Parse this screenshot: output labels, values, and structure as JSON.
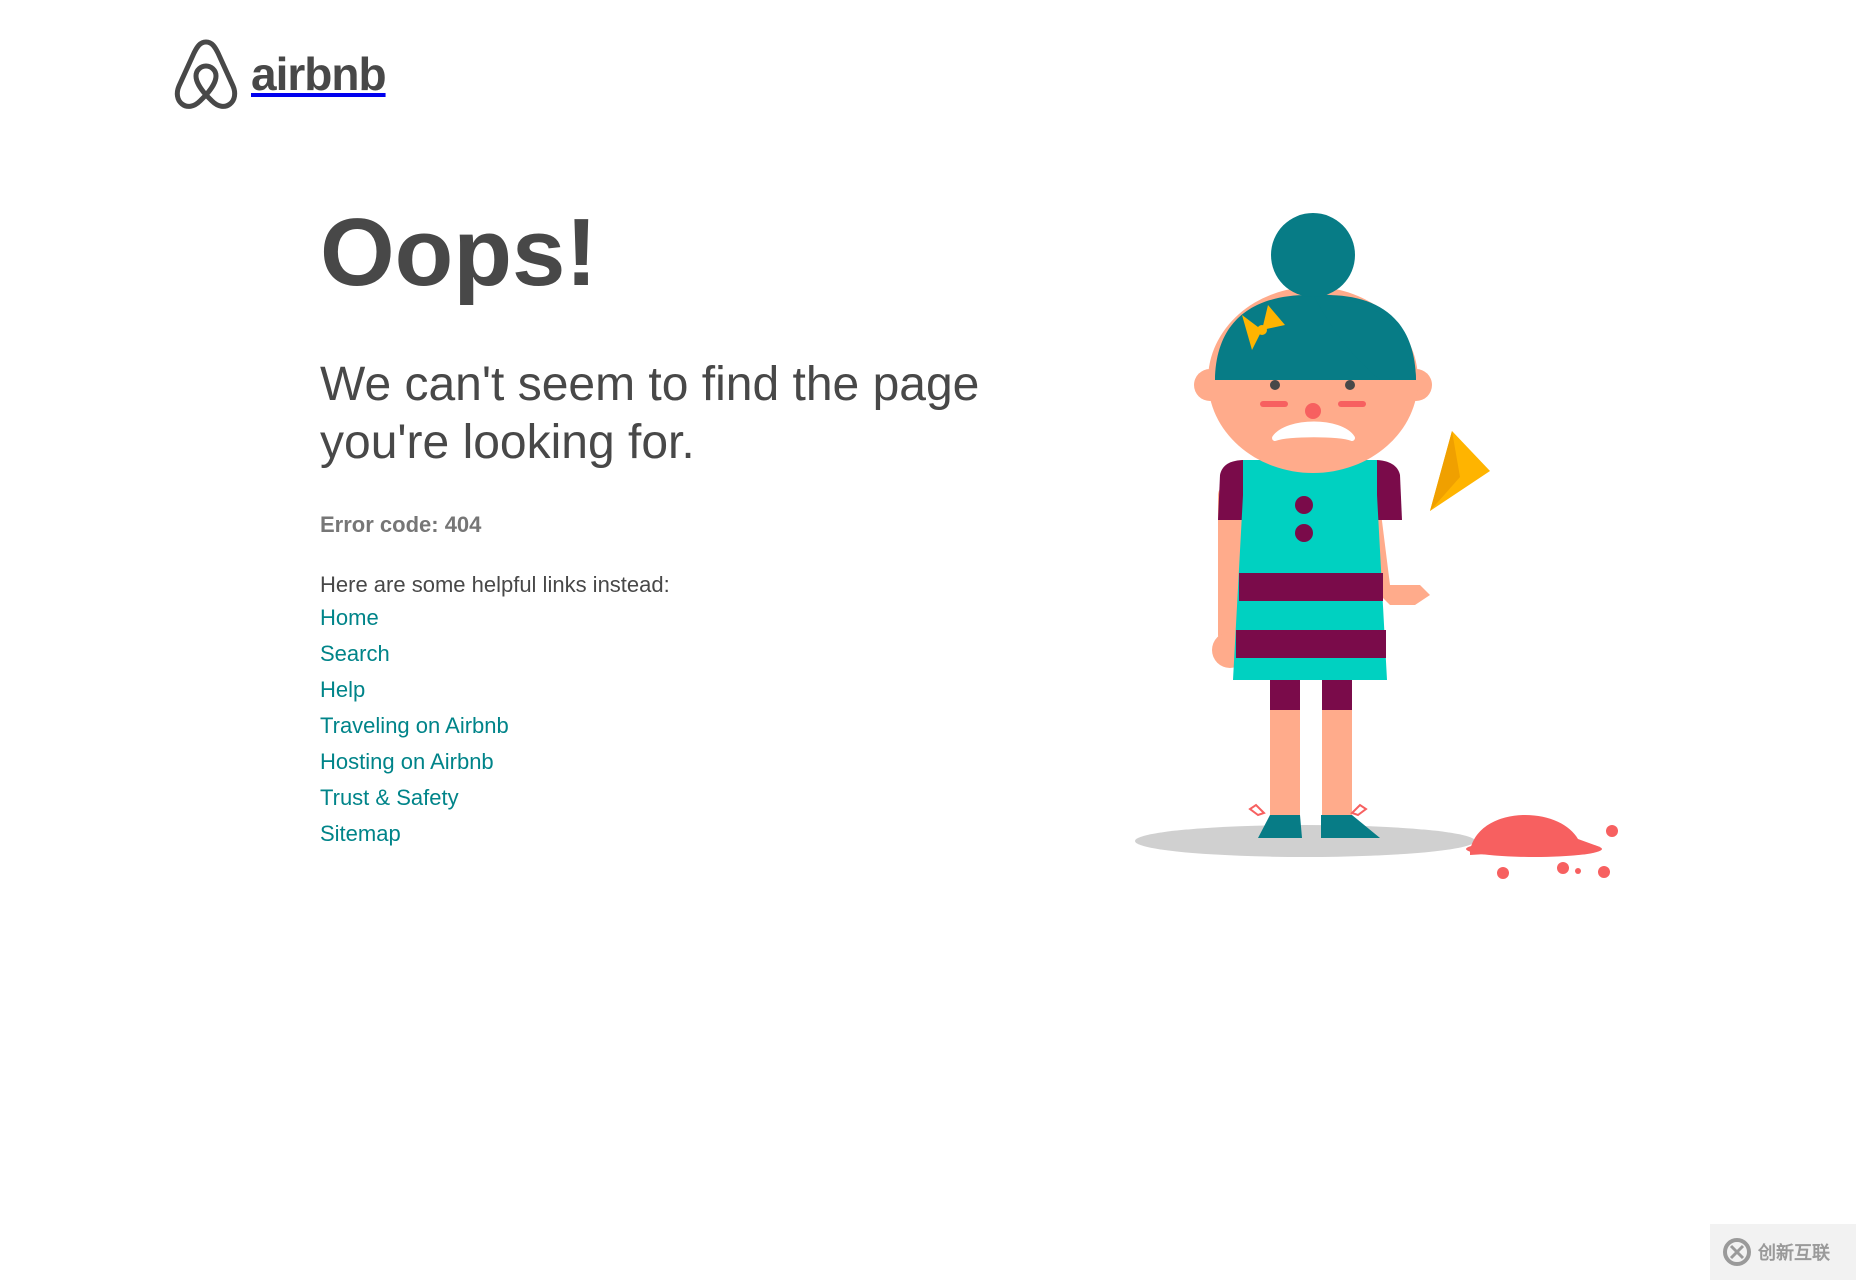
{
  "brand": {
    "name": "airbnb",
    "color": "#484848",
    "accent": "#008489"
  },
  "error": {
    "title": "Oops!",
    "message": "We can't seem to find the page you're looking for.",
    "code": "Error code: 404"
  },
  "links_intro": "Here are some helpful links instead:",
  "links": [
    {
      "label": "Home"
    },
    {
      "label": "Search"
    },
    {
      "label": "Help"
    },
    {
      "label": "Traveling on Airbnb"
    },
    {
      "label": "Hosting on Airbnb"
    },
    {
      "label": "Trust & Safety"
    },
    {
      "label": "Sitemap"
    }
  ],
  "illustration": {
    "name": "sad-girl-dropped-ice-cream-illustration"
  },
  "watermark": {
    "text": "创新互联"
  }
}
